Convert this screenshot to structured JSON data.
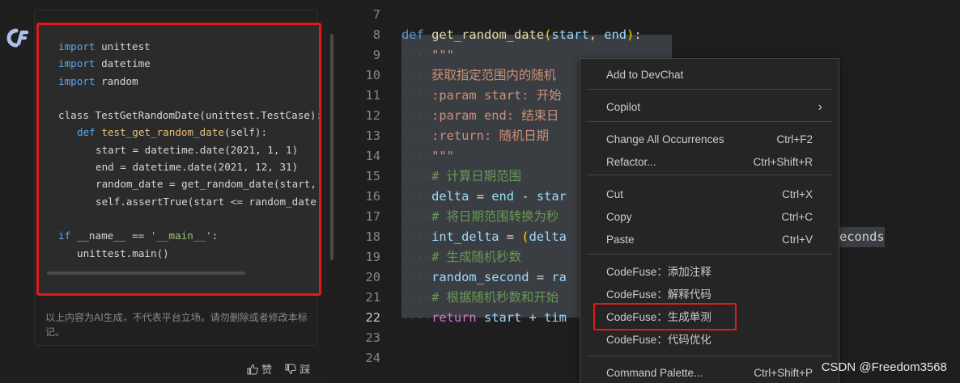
{
  "chat": {
    "code_lines": [
      {
        "indent": 0,
        "tokens": [
          {
            "t": "kw",
            "v": "import"
          },
          {
            "t": "",
            "v": " unittest"
          }
        ]
      },
      {
        "indent": 0,
        "tokens": [
          {
            "t": "kw",
            "v": "import"
          },
          {
            "t": "",
            "v": " datetime"
          }
        ]
      },
      {
        "indent": 0,
        "tokens": [
          {
            "t": "kw",
            "v": "import"
          },
          {
            "t": "",
            "v": " random"
          }
        ]
      },
      {
        "indent": 0,
        "tokens": []
      },
      {
        "indent": 0,
        "tokens": [
          {
            "t": "",
            "v": "class TestGetRandomDate(unittest.TestCase):"
          }
        ]
      },
      {
        "indent": 1,
        "tokens": [
          {
            "t": "kw",
            "v": "def"
          },
          {
            "t": "",
            "v": " "
          },
          {
            "t": "fn",
            "v": "test_get_random_date"
          },
          {
            "t": "",
            "v": "(self):"
          }
        ]
      },
      {
        "indent": 2,
        "tokens": [
          {
            "t": "",
            "v": "start = datetime.date(2021, 1, 1)"
          }
        ]
      },
      {
        "indent": 2,
        "tokens": [
          {
            "t": "",
            "v": "end = datetime.date(2021, 12, 31)"
          }
        ]
      },
      {
        "indent": 2,
        "tokens": [
          {
            "t": "",
            "v": "random_date = get_random_date(start, end)"
          }
        ]
      },
      {
        "indent": 2,
        "tokens": [
          {
            "t": "",
            "v": "self.assertTrue(start <= random_date <= end)"
          }
        ]
      },
      {
        "indent": 0,
        "tokens": []
      },
      {
        "indent": 0,
        "tokens": [
          {
            "t": "kw",
            "v": "if"
          },
          {
            "t": "",
            "v": " __name__ == "
          },
          {
            "t": "st",
            "v": "'__main__'"
          },
          {
            "t": "",
            "v": ":"
          }
        ]
      },
      {
        "indent": 1,
        "tokens": [
          {
            "t": "",
            "v": "unittest.main()"
          }
        ]
      }
    ],
    "disclaimer": "以上内容为AI生成，不代表平台立场。请勿删除或者修改本标记。",
    "like_label": "赞",
    "dislike_label": "踩"
  },
  "editor": {
    "line_numbers": [
      "7",
      "8",
      "9",
      "10",
      "11",
      "12",
      "13",
      "14",
      "15",
      "16",
      "17",
      "18",
      "19",
      "20",
      "21",
      "22",
      "23",
      "24"
    ],
    "active_line": "22",
    "lines": [
      {
        "n": "7",
        "dots": 0,
        "tokens": []
      },
      {
        "n": "8",
        "dots": 0,
        "tokens": [
          {
            "t": "ed-kw",
            "v": "def"
          },
          {
            "t": "",
            "v": " "
          },
          {
            "t": "ed-fn",
            "v": "get_random_date"
          },
          {
            "t": "ed-br",
            "v": "("
          },
          {
            "t": "ed-var",
            "v": "start"
          },
          {
            "t": "",
            "v": ", "
          },
          {
            "t": "ed-var",
            "v": "end"
          },
          {
            "t": "ed-br",
            "v": ")"
          },
          {
            "t": "",
            "v": ":"
          }
        ]
      },
      {
        "n": "9",
        "dots": 4,
        "tokens": [
          {
            "t": "ed-str",
            "v": "\"\"\""
          }
        ]
      },
      {
        "n": "10",
        "dots": 4,
        "tokens": [
          {
            "t": "ed-str",
            "v": "获取指定范围内的随机"
          }
        ]
      },
      {
        "n": "11",
        "dots": 4,
        "tokens": [
          {
            "t": "ed-str",
            "v": ":param start: 开始"
          }
        ]
      },
      {
        "n": "12",
        "dots": 4,
        "tokens": [
          {
            "t": "ed-str",
            "v": ":param end: 结束日"
          }
        ]
      },
      {
        "n": "13",
        "dots": 4,
        "tokens": [
          {
            "t": "ed-str",
            "v": ":return: 随机日期"
          }
        ]
      },
      {
        "n": "14",
        "dots": 4,
        "tokens": [
          {
            "t": "ed-str",
            "v": "\"\"\""
          }
        ]
      },
      {
        "n": "15",
        "dots": 4,
        "tokens": [
          {
            "t": "ed-cm",
            "v": "# 计算日期范围"
          }
        ]
      },
      {
        "n": "16",
        "dots": 4,
        "tokens": [
          {
            "t": "ed-var",
            "v": "delta"
          },
          {
            "t": "",
            "v": " = "
          },
          {
            "t": "ed-var",
            "v": "end"
          },
          {
            "t": "",
            "v": " - "
          },
          {
            "t": "ed-var",
            "v": "star"
          }
        ]
      },
      {
        "n": "17",
        "dots": 4,
        "tokens": [
          {
            "t": "ed-cm",
            "v": "# 将日期范围转换为秒"
          }
        ]
      },
      {
        "n": "18",
        "dots": 4,
        "tokens": [
          {
            "t": "ed-var",
            "v": "int_delta"
          },
          {
            "t": "",
            "v": " = "
          },
          {
            "t": "ed-br",
            "v": "("
          },
          {
            "t": "ed-var",
            "v": "delta"
          }
        ]
      },
      {
        "n": "19",
        "dots": 4,
        "tokens": [
          {
            "t": "ed-cm",
            "v": "# 生成随机秒数"
          }
        ]
      },
      {
        "n": "20",
        "dots": 4,
        "tokens": [
          {
            "t": "ed-var",
            "v": "random_second"
          },
          {
            "t": "",
            "v": " = "
          },
          {
            "t": "ed-var",
            "v": "ra"
          }
        ]
      },
      {
        "n": "21",
        "dots": 4,
        "tokens": [
          {
            "t": "ed-cm",
            "v": "# 根据随机秒数和开始"
          }
        ]
      },
      {
        "n": "22",
        "dots": 4,
        "tokens": [
          {
            "t": "ed-br2",
            "v": "return"
          },
          {
            "t": "",
            "v": " "
          },
          {
            "t": "ed-var",
            "v": "start"
          },
          {
            "t": "",
            "v": " + "
          },
          {
            "t": "ed-var",
            "v": "tim"
          }
        ]
      },
      {
        "n": "23",
        "dots": 0,
        "tokens": []
      },
      {
        "n": "24",
        "dots": 0,
        "tokens": []
      }
    ],
    "overflow_text_line18": "econds"
  },
  "context_menu": {
    "items": [
      {
        "label": "Add to DevChat",
        "shortcut": "",
        "submenu": false
      },
      {
        "label": "Copilot",
        "shortcut": "",
        "submenu": true
      },
      {
        "label": "Change All Occurrences",
        "shortcut": "Ctrl+F2",
        "submenu": false
      },
      {
        "label": "Refactor...",
        "shortcut": "Ctrl+Shift+R",
        "submenu": false
      },
      {
        "label": "Cut",
        "shortcut": "Ctrl+X",
        "submenu": false
      },
      {
        "label": "Copy",
        "shortcut": "Ctrl+C",
        "submenu": false
      },
      {
        "label": "Paste",
        "shortcut": "Ctrl+V",
        "submenu": false
      },
      {
        "label": "CodeFuse：添加注释",
        "shortcut": "",
        "submenu": false
      },
      {
        "label": "CodeFuse：解释代码",
        "shortcut": "",
        "submenu": false
      },
      {
        "label": "CodeFuse：生成单测",
        "shortcut": "",
        "submenu": false
      },
      {
        "label": "CodeFuse：代码优化",
        "shortcut": "",
        "submenu": false
      },
      {
        "label": "Command Palette...",
        "shortcut": "Ctrl+Shift+P",
        "submenu": false
      }
    ]
  },
  "watermark": "CSDN @Freedom3568",
  "colors": {
    "highlight_border": "#e21a1a",
    "keyword": "#569cd6",
    "comment": "#6a9955",
    "string": "#ce9178"
  },
  "icons": {
    "assistant_avatar": "codefuse-logo-icon",
    "like": "thumb-up-icon",
    "dislike": "thumb-down-icon",
    "submenu": "chevron-right-icon"
  }
}
